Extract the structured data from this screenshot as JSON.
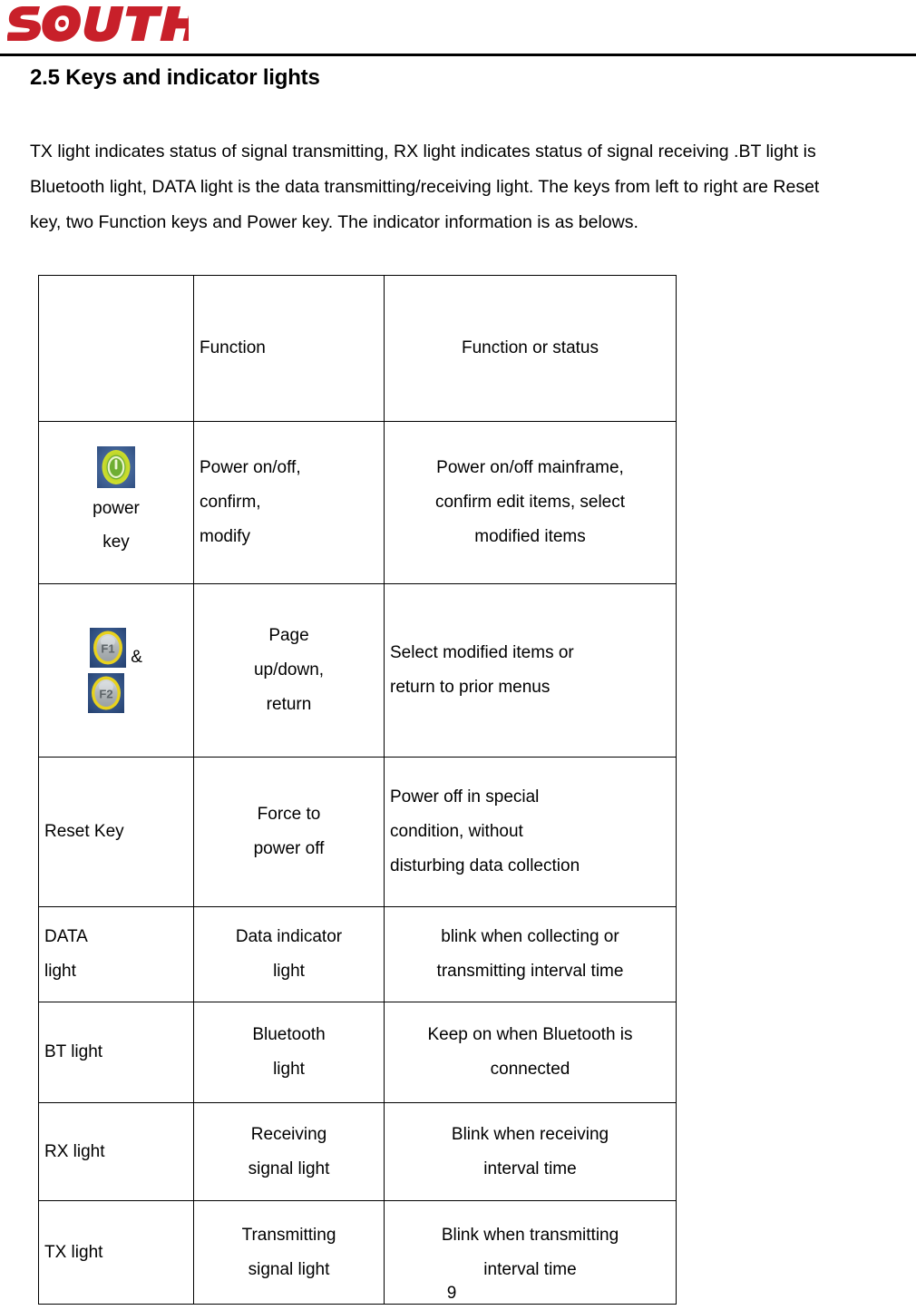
{
  "header": {
    "logo_text": "SOUTH",
    "logo_color": "#C8202A"
  },
  "section": {
    "heading": "2.5 Keys and indicator lights"
  },
  "intro": {
    "lines": [
      "TX light indicates status of signal transmitting, RX light indicates status of signal receiving .BT light is",
      "Bluetooth light, DATA light is the data transmitting/receiving light. The keys from left to right are Reset",
      "key, two Function keys and Power key. The indicator information is as belows."
    ]
  },
  "table": {
    "headers": {
      "col1": "",
      "col2": "Function",
      "col3": "Function or status"
    },
    "rows": [
      {
        "id": "power-key",
        "col1_icon": "power-key-icon",
        "col1_lines": [
          "power",
          "key"
        ],
        "col2_lines": [
          "Power on/off,",
          "confirm,",
          "modify"
        ],
        "col3_lines": [
          "Power on/off mainframe,",
          "confirm edit items, select",
          "modified items"
        ]
      },
      {
        "id": "function-keys",
        "col1_icon_1": "f1-key-icon",
        "col1_icon_2": "f2-key-icon",
        "col1_separator": "&",
        "col2_lines": [
          "Page",
          "up/down,",
          "return"
        ],
        "col3_lines": [
          "Select modified items or",
          "return to prior menus"
        ]
      },
      {
        "id": "reset-key",
        "col1_lines": [
          "Reset Key"
        ],
        "col2_lines": [
          "Force to",
          "power off"
        ],
        "col3_lines": [
          "Power off in special",
          "condition, without",
          "disturbing data collection"
        ]
      },
      {
        "id": "data-light",
        "col1_lines": [
          "DATA",
          "light"
        ],
        "col2_lines": [
          "Data indicator",
          "light"
        ],
        "col3_lines": [
          "blink when collecting    or",
          "transmitting interval time"
        ]
      },
      {
        "id": "bt-light",
        "col1_lines": [
          "BT light"
        ],
        "col2_lines": [
          "Bluetooth",
          "light"
        ],
        "col3_lines": [
          "Keep on when Bluetooth is",
          "connected"
        ]
      },
      {
        "id": "rx-light",
        "col1_lines": [
          "RX light"
        ],
        "col2_lines": [
          "Receiving",
          "signal light"
        ],
        "col3_lines": [
          "Blink when receiving",
          "interval time"
        ]
      },
      {
        "id": "tx-light",
        "col1_lines": [
          "TX light"
        ],
        "col2_lines": [
          "Transmitting",
          "signal light"
        ],
        "col3_lines": [
          "Blink when transmitting",
          "interval time"
        ]
      }
    ]
  },
  "footer": {
    "page_number": "9"
  },
  "icons": {
    "power_key": {
      "name": "power-key-icon",
      "background": "#3a5a8c",
      "glow": "#cfe02a",
      "inner": "#6aa82e"
    },
    "f1_key": {
      "name": "f1-key-icon",
      "label": "F1",
      "background": "#2d4f86",
      "rim": "#e8d21e",
      "face": "#b5b9bc"
    },
    "f2_key": {
      "name": "f2-key-icon",
      "label": "F2",
      "background": "#2d4f86",
      "rim": "#e8d21e",
      "face": "#b5b9bc"
    }
  }
}
